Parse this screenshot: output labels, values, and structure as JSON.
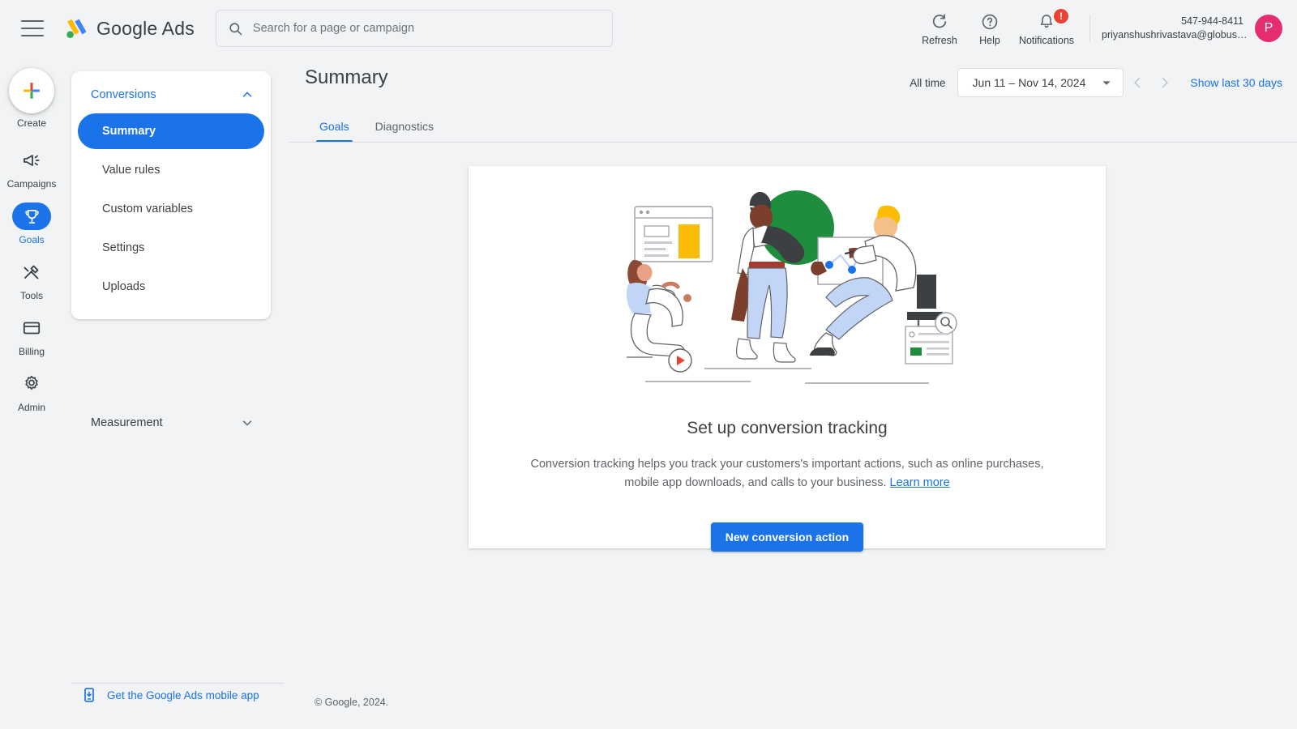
{
  "header": {
    "menu_icon": "hamburger-menu-icon",
    "brand": "Google Ads",
    "search": {
      "icon": "search-icon",
      "placeholder": "Search for a page or campaign",
      "value": ""
    },
    "actions": [
      {
        "label": "Refresh",
        "icon": "refresh-icon"
      },
      {
        "label": "Help",
        "icon": "help-circle-icon"
      },
      {
        "label": "Notifications",
        "icon": "bell-icon",
        "badge": "!"
      }
    ],
    "account": {
      "phone": "547-944-8411",
      "email": "priyanshushrivastava@globus…",
      "avatar_initial": "P",
      "avatar_color": "#e52e71"
    }
  },
  "rail": {
    "create": {
      "label": "Create",
      "icon": "plus-icon"
    },
    "items": [
      {
        "label": "Campaigns",
        "icon": "megaphone-icon",
        "active": false
      },
      {
        "label": "Goals",
        "icon": "trophy-icon",
        "active": true
      },
      {
        "label": "Tools",
        "icon": "tools-icon",
        "active": false
      },
      {
        "label": "Billing",
        "icon": "credit-card-icon",
        "active": false
      },
      {
        "label": "Admin",
        "icon": "gear-icon",
        "active": false
      }
    ]
  },
  "nav": {
    "section_title": "Conversions",
    "section_expanded_icon": "chevron-up-icon",
    "items": [
      {
        "label": "Summary",
        "active": true
      },
      {
        "label": "Value rules",
        "active": false
      },
      {
        "label": "Custom variables",
        "active": false
      },
      {
        "label": "Settings",
        "active": false
      },
      {
        "label": "Uploads",
        "active": false
      }
    ],
    "collapsed_section": {
      "title": "Measurement",
      "icon": "chevron-down-icon"
    }
  },
  "main": {
    "page_title": "Summary",
    "date_bar": {
      "all_time_label": "All time",
      "range": "Jun 11 – Nov 14, 2024",
      "dropdown_icon": "chevron-down-icon",
      "prev_icon": "chevron-left-icon",
      "next_icon": "chevron-right-icon",
      "show_last_link": "Show last 30 days"
    },
    "tabs": [
      {
        "label": "Goals",
        "active": true
      },
      {
        "label": "Diagnostics",
        "active": false
      }
    ],
    "empty_state": {
      "illustration": "conversion-tracking-illustration",
      "title": "Set up conversion tracking",
      "description_part1": "Conversion tracking helps you track your customers's important actions, such as online purchases, mobile app downloads, and calls to your business. ",
      "learn_more": "Learn more",
      "cta_label": "New conversion action"
    }
  },
  "footer": {
    "mobile_app_label": "Get the Google Ads mobile app",
    "mobile_app_icon": "mobile-download-icon",
    "copyright": "© Google, 2024."
  },
  "colors": {
    "accent_blue": "#1a73e8",
    "page_bg": "#f1f3f4",
    "text_primary": "#3c4043",
    "text_secondary": "#5f6368",
    "badge_red": "#ea4335",
    "illustration_green": "#1e8e3e",
    "illustration_yellow": "#fbbc04"
  }
}
